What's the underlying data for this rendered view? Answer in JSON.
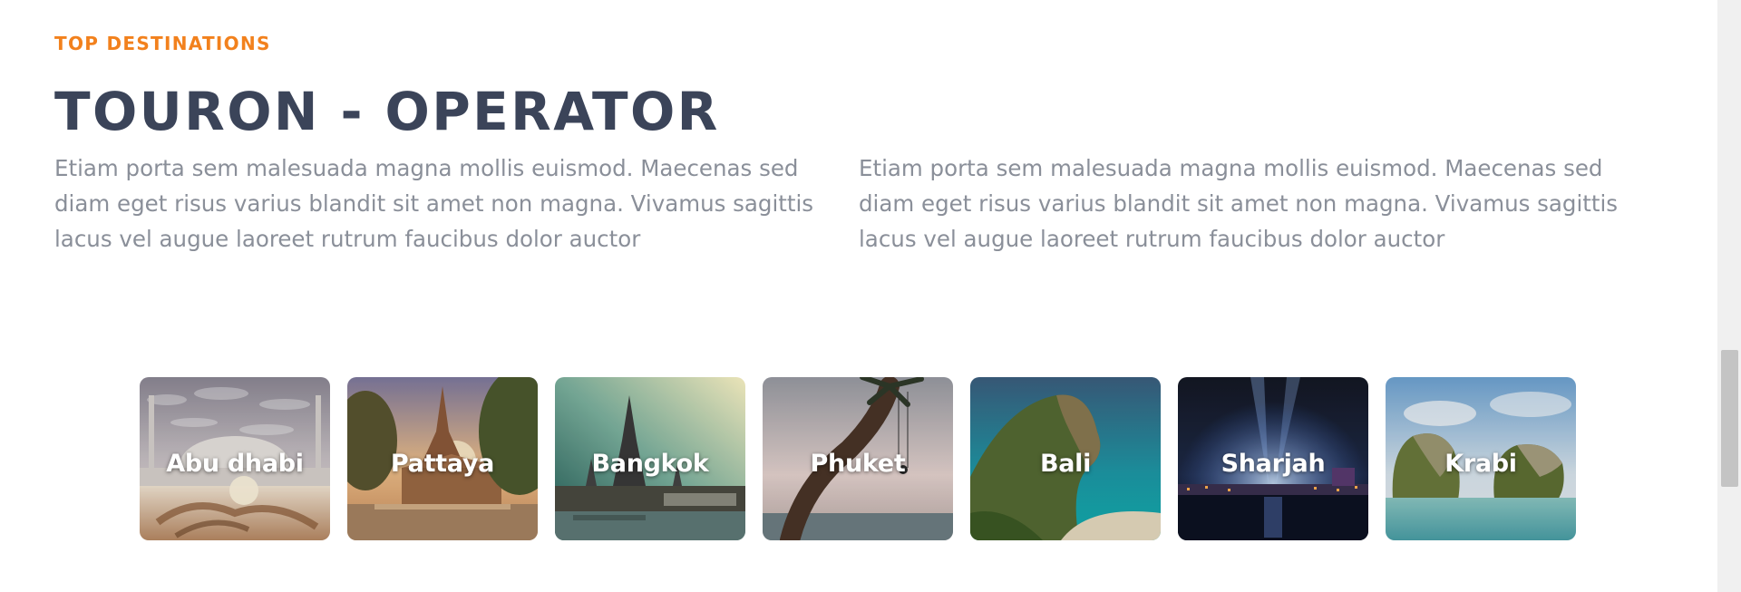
{
  "section": {
    "eyebrow": "TOP DESTINATIONS",
    "title": "TOURON - OPERATOR",
    "intro_left": "Etiam porta sem malesuada magna mollis euismod. Maecenas sed diam eget risus varius blandit sit amet non magna. Vivamus sagittis lacus vel augue laoreet rutrum faucibus dolor auctor",
    "intro_right": "Etiam porta sem malesuada magna mollis euismod. Maecenas sed diam eget risus varius blandit sit amet non magna. Vivamus sagittis lacus vel augue laoreet rutrum faucibus dolor auctor"
  },
  "destinations": [
    {
      "name": "Abu dhabi",
      "image": "mosque-photo"
    },
    {
      "name": "Pattaya",
      "image": "temple-sunset-photo"
    },
    {
      "name": "Bangkok",
      "image": "river-temple-photo"
    },
    {
      "name": "Phuket",
      "image": "palm-swing-photo"
    },
    {
      "name": "Bali",
      "image": "cliff-beach-photo"
    },
    {
      "name": "Sharjah",
      "image": "night-city-photo"
    },
    {
      "name": "Krabi",
      "image": "limestone-islands-photo"
    }
  ],
  "colors": {
    "accent": "#f2811d",
    "heading": "#3b4459",
    "body_text": "#8a8f99"
  }
}
